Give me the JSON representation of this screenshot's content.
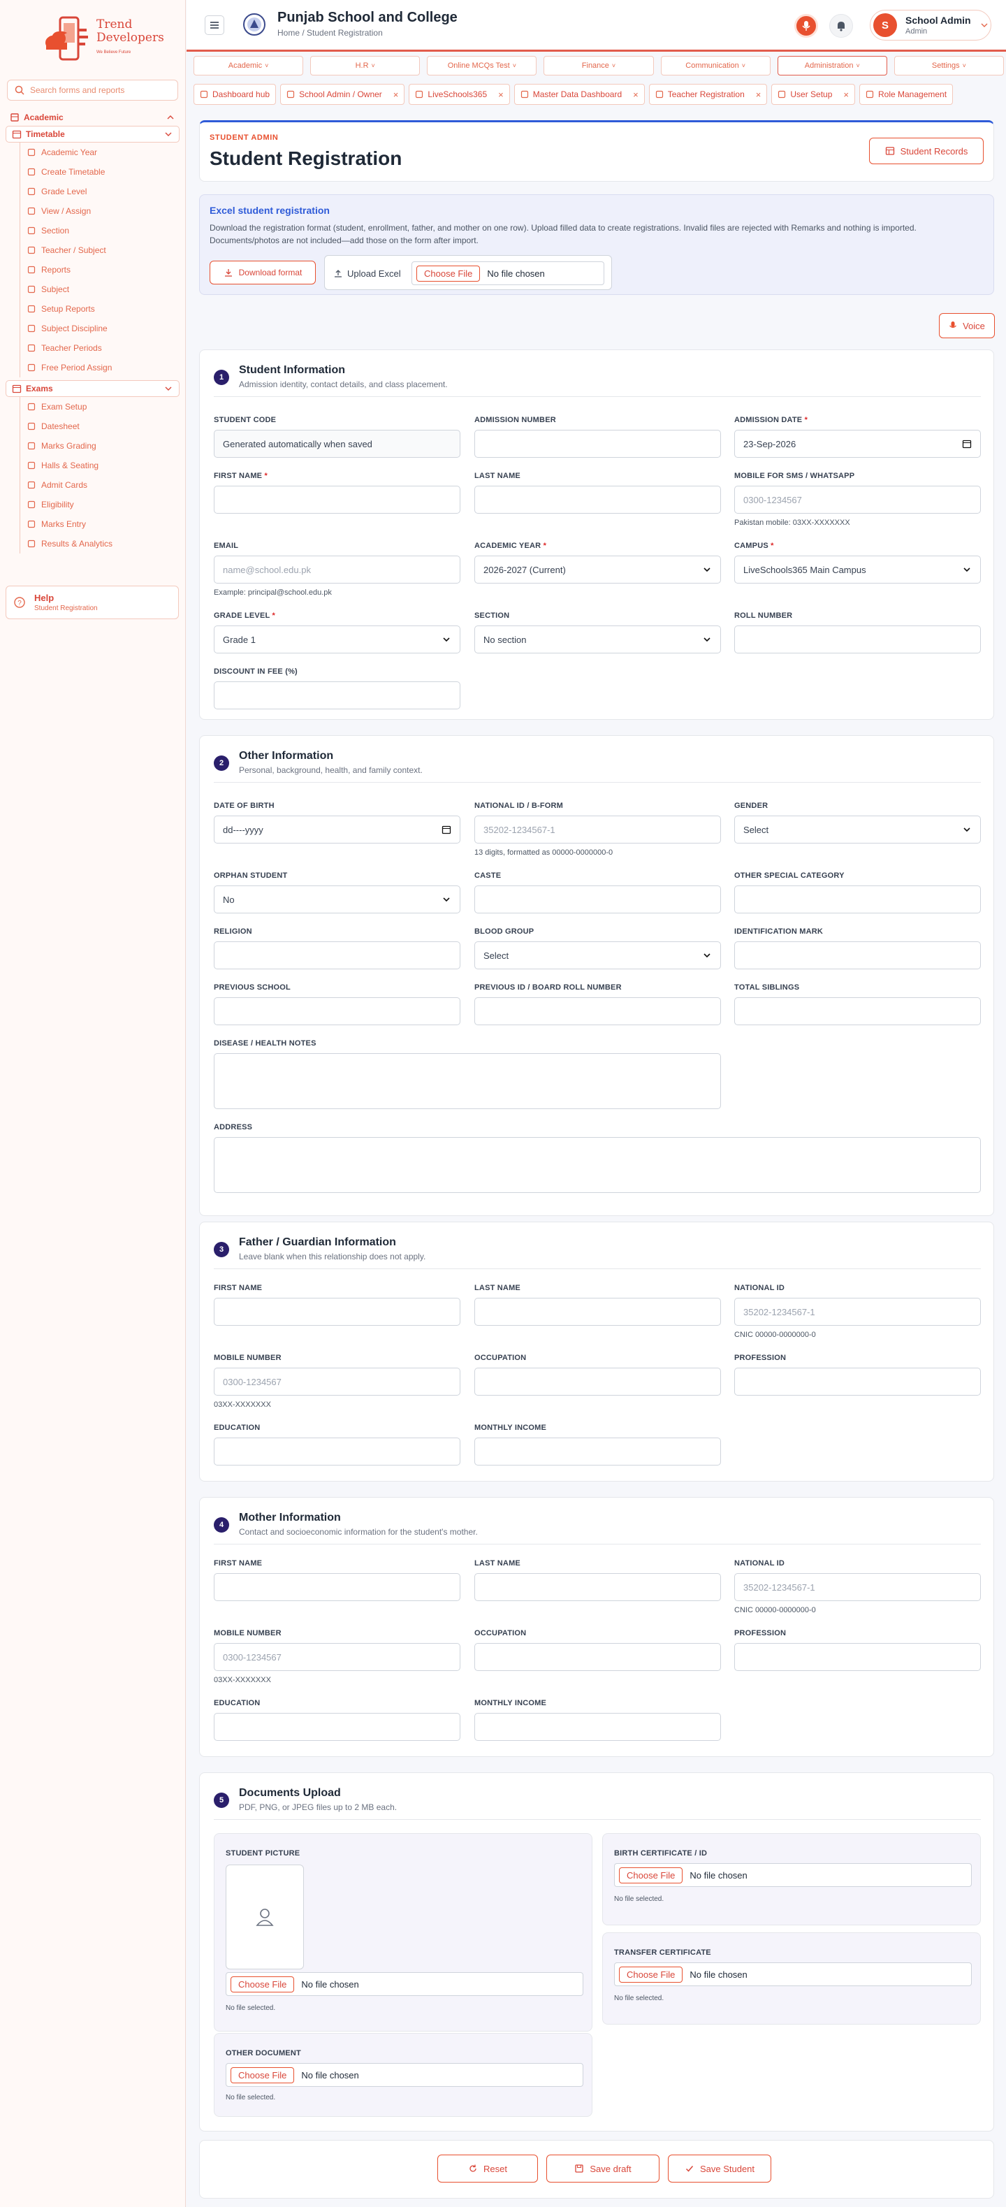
{
  "brand": {
    "name_line1": "Trend",
    "name_line2": "Developers",
    "tagline": "We Believe Future"
  },
  "sidebar": {
    "search_placeholder": "Search forms and reports",
    "academic": "Academic",
    "timetable": "Timetable",
    "timetable_items": [
      "Academic Year",
      "Create Timetable",
      "Grade Level",
      "View / Assign",
      "Section",
      "Teacher / Subject",
      "Reports",
      "Subject",
      "Setup Reports",
      "Subject Discipline",
      "Teacher Periods",
      "Free Period Assign"
    ],
    "exams": "Exams",
    "exam_items": [
      "Exam Setup",
      "Datesheet",
      "Marks Grading",
      "Halls & Seating",
      "Admit Cards",
      "Eligibility",
      "Marks Entry",
      "Results & Analytics"
    ],
    "help_title": "Help",
    "help_sub": "Student Registration"
  },
  "header": {
    "school": "Punjab School and College",
    "breadcrumb": "Home / Student Registration",
    "user_initial": "S",
    "user_name": "School Admin",
    "user_role": "Admin"
  },
  "topnav": [
    "Academic",
    "H.R",
    "Online MCQs Test",
    "Finance",
    "Communication",
    "Administration",
    "Settings"
  ],
  "tabs": [
    "Dashboard hub",
    "School Admin / Owner",
    "LiveSchools365",
    "Master Data Dashboard",
    "Teacher Registration",
    "User Setup",
    "Role Management"
  ],
  "page": {
    "eyebrow": "STUDENT ADMIN",
    "title": "Student Registration",
    "records_btn": "Student Records"
  },
  "excel": {
    "title": "Excel student registration",
    "desc": "Download the registration format (student, enrollment, father, and mother on one row). Upload filled data to create registrations. Invalid files are rejected with Remarks and nothing is imported. Documents/photos are not included—add those on the form after import.",
    "download": "Download format",
    "upload": "Upload Excel",
    "choose": "Choose File",
    "nofile": "No file chosen"
  },
  "voice": "Voice",
  "s1": {
    "num": "1",
    "title": "Student Information",
    "sub": "Admission identity, contact details, and class placement.",
    "student_code": "STUDENT CODE",
    "student_code_val": "Generated automatically when saved",
    "admission_number": "ADMISSION NUMBER",
    "admission_date": "ADMISSION DATE",
    "admission_date_val": "23-Sep-2026",
    "first_name": "FIRST NAME",
    "last_name": "LAST NAME",
    "mobile": "MOBILE FOR SMS / WHATSAPP",
    "mobile_ph": "0300-1234567",
    "mobile_hint": "Pakistan mobile: 03XX-XXXXXXX",
    "email": "EMAIL",
    "email_ph": "name@school.edu.pk",
    "email_hint": "Example: principal@school.edu.pk",
    "academic_year": "ACADEMIC YEAR",
    "academic_year_val": "2026-2027 (Current)",
    "campus": "CAMPUS",
    "campus_val": "LiveSchools365 Main Campus",
    "grade_level": "GRADE LEVEL",
    "grade_level_val": "Grade 1",
    "section": "SECTION",
    "section_val": "No section",
    "roll": "ROLL NUMBER",
    "discount": "DISCOUNT IN FEE (%)"
  },
  "s2": {
    "num": "2",
    "title": "Other Information",
    "sub": "Personal, background, health, and family context.",
    "dob": "DATE OF BIRTH",
    "dob_ph": "dd----yyyy",
    "nid": "NATIONAL ID / B-FORM",
    "nid_ph": "35202-1234567-1",
    "nid_hint": "13 digits, formatted as 00000-0000000-0",
    "gender": "GENDER",
    "gender_val": "Select",
    "orphan": "ORPHAN STUDENT",
    "orphan_val": "No",
    "caste": "CASTE",
    "special": "OTHER SPECIAL CATEGORY",
    "religion": "RELIGION",
    "blood": "BLOOD GROUP",
    "blood_val": "Select",
    "idmark": "IDENTIFICATION MARK",
    "prev_school": "PREVIOUS SCHOOL",
    "prev_roll": "PREVIOUS ID / BOARD ROLL NUMBER",
    "siblings": "TOTAL SIBLINGS",
    "disease": "DISEASE / HEALTH NOTES",
    "address": "ADDRESS"
  },
  "s3": {
    "num": "3",
    "title": "Father / Guardian Information",
    "sub": "Leave blank when this relationship does not apply.",
    "first_name": "FIRST NAME",
    "last_name": "LAST NAME",
    "nid": "NATIONAL ID",
    "nid_ph": "35202-1234567-1",
    "nid_hint": "CNIC 00000-0000000-0",
    "mobile": "MOBILE NUMBER",
    "mobile_ph": "0300-1234567",
    "mobile_hint": "03XX-XXXXXXX",
    "occupation": "OCCUPATION",
    "profession": "PROFESSION",
    "education": "EDUCATION",
    "income": "MONTHLY INCOME"
  },
  "s4": {
    "num": "4",
    "title": "Mother Information",
    "sub": "Contact and socioeconomic information for the student's mother.",
    "first_name": "FIRST NAME",
    "last_name": "LAST NAME",
    "nid": "NATIONAL ID",
    "nid_ph": "35202-1234567-1",
    "nid_hint": "CNIC 00000-0000000-0",
    "mobile": "MOBILE NUMBER",
    "mobile_ph": "0300-1234567",
    "mobile_hint": "03XX-XXXXXXX",
    "occupation": "OCCUPATION",
    "profession": "PROFESSION",
    "education": "EDUCATION",
    "income": "MONTHLY INCOME"
  },
  "s5": {
    "num": "5",
    "title": "Documents Upload",
    "sub": "PDF, PNG, or JPEG files up to 2 MB each.",
    "picture": "STUDENT PICTURE",
    "birth": "BIRTH CERTIFICATE / ID",
    "transfer": "TRANSFER CERTIFICATE",
    "other": "OTHER DOCUMENT",
    "choose": "Choose File",
    "nofile": "No file chosen",
    "noselected": "No file selected."
  },
  "actions": {
    "reset": "Reset",
    "draft": "Save draft",
    "save": "Save Student"
  },
  "colors": {
    "accent": "#e8502f",
    "brand_red": "#d9473a",
    "section_badge": "#2a1f6b",
    "excel_bg": "#eef0fb"
  }
}
